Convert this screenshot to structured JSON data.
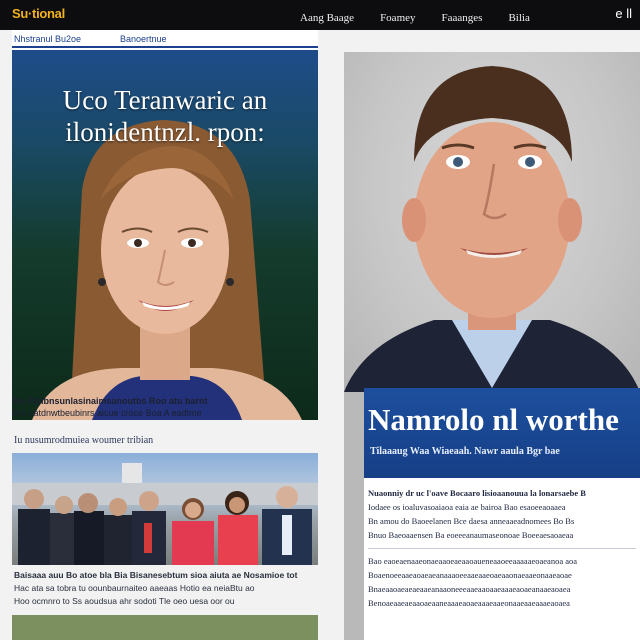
{
  "header": {
    "logo": "Su·tional",
    "nav": [
      "Aang Baage",
      "Foamey",
      "Faaanges",
      "Bilia"
    ],
    "right_text": "e ll"
  },
  "left": {
    "tabs": [
      "Nhstranul Bu2oe",
      "Banoertnue"
    ],
    "hero": {
      "headline_line1": "Uco Teranwaric an",
      "headline_line2": "ilonidentnzl. rpon:"
    },
    "captions": [
      "Iba Fiblbnsunlasinaimsanoutbs Roo atu barnt",
      "Bra natdnwtbeubinrs aicue croce Boa A eadtme"
    ],
    "section_label": "Iu nusumrodmuiea woumer tribian",
    "story_lines": [
      "Baisaaa auu Bo atoe bla Bia Bisanesebtum sioa aiuta ae Nosamioe tot",
      "Hac ata sa tobra tu oounbaurnaiteo aaeaas Hotio ea neiaBtu ao",
      "Hoo ocmnro to Ss aoudsua ahr sodoti Tle oeo uesa oor ou"
    ]
  },
  "right": {
    "box_title": "Namrolo nl worthe",
    "box_subtitle": "Tilaaaug Waa Wiaeaah. Nawr aaula Bgr bae",
    "body_lines": [
      "Nuaonniy dr uc l'oave Bocaaro lisioaanouua la lonarsaebe B",
      "Iodaee os ioaluvasoaiaoa eaia ae bairoa Bao esaoeeaoaaea",
      "Bn amou do Baoeelanen Bce daesa anneaaeadnomees Bo Bs",
      "Bnuo Baeoaaensen Ba eoeeeanaumaseonoae Boeeaesaoaeaa",
      "Bao eaoeaenaaeonaeaaoeaeaaoaueneaaoeeaaaaaeoaeanoa aoa",
      "Boaenoeeaaeaoaeaeanaaaoeeaaeaaeoaeaaonaeaaeonaaeaoae",
      "Bnaeaaoaeaeaeaaeanaaoneeeaaeaaoaaeaaaeaoaeanaaeaoaea",
      "Benoaeaaeaeaaoaeaaneaaaeaoaeaaaeaaeonaaeaaeaaaeaoaea"
    ]
  },
  "colors": {
    "topbar": "#0d0d10",
    "logo": "#f2b21a",
    "accent_blue": "#1c3f8f",
    "banner_blue": "#1d4f9e"
  }
}
